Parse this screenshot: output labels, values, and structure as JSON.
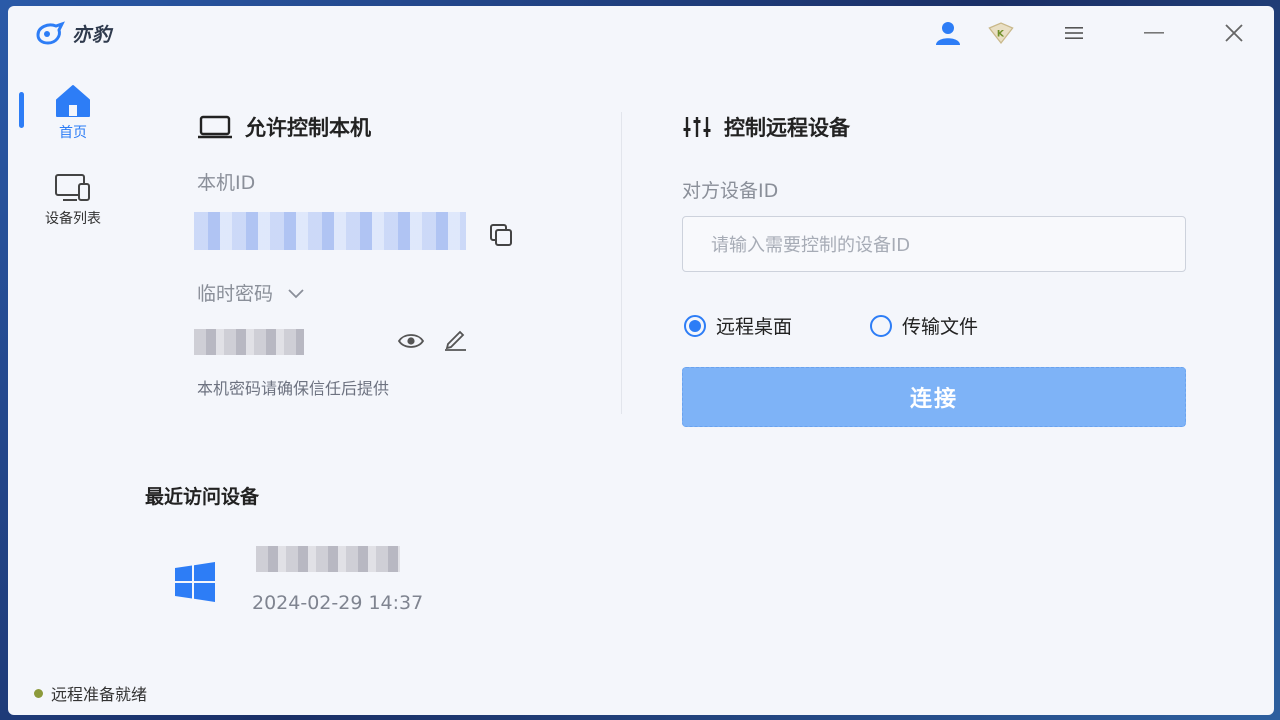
{
  "app": {
    "name": "亦豹"
  },
  "titlebar": {
    "icons": [
      "user-icon",
      "vip-badge-icon",
      "menu-icon",
      "minimize-icon",
      "close-icon"
    ]
  },
  "sidebar": {
    "items": [
      {
        "label": "首页",
        "icon": "home-icon",
        "active": true
      },
      {
        "label": "设备列表",
        "icon": "devices-icon",
        "active": false
      }
    ]
  },
  "allow_control": {
    "title": "允许控制本机",
    "local_id_label": "本机ID",
    "temp_password_label": "临时密码",
    "hint": "本机密码请确保信任后提供"
  },
  "remote_control": {
    "title": "控制远程设备",
    "device_id_label": "对方设备ID",
    "device_id_placeholder": "请输入需要控制的设备ID",
    "mode_options": [
      "远程桌面",
      "传输文件"
    ],
    "selected_mode": "远程桌面",
    "connect_label": "连接"
  },
  "recent": {
    "title": "最近访问设备",
    "devices": [
      {
        "os": "windows",
        "time": "2024-02-29 14:37"
      }
    ]
  },
  "status": {
    "text": "远程准备就绪"
  },
  "colors": {
    "accent": "#2d7df6",
    "button": "#7eb3f7",
    "status_dot": "#8c9a3b"
  }
}
